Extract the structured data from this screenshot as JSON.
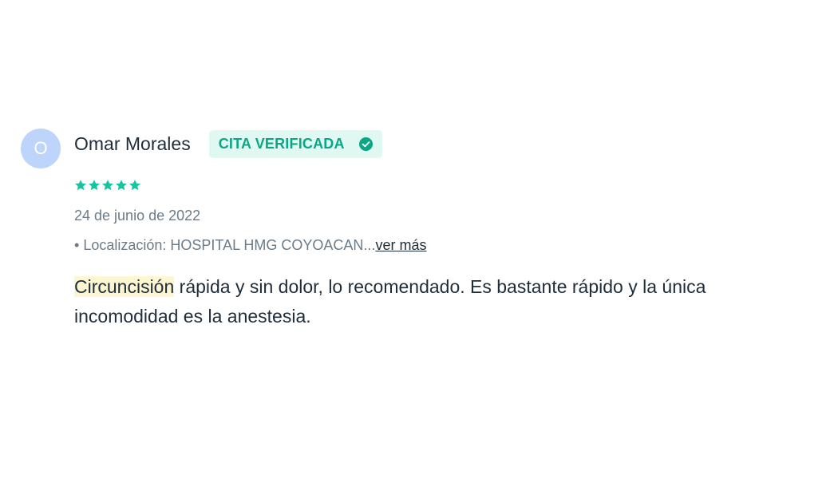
{
  "review": {
    "avatar_initial": "O",
    "author": "Omar Morales",
    "badge_label": "CITA VERIFICADA",
    "rating_value": 5,
    "rating_max": 5,
    "date": "24 de junio de 2022",
    "location_bullet": "•",
    "location_text": "Localización: HOSPITAL HMG COYOACAN...",
    "see_more_label": "ver más",
    "text_highlight": "Circuncisión",
    "text_rest": " rápida y sin dolor, lo recomendado. Es bastante rápido y la única incomodidad es la anestesia."
  },
  "colors": {
    "avatar_bg": "#bdd4fb",
    "badge_bg": "#dff8f2",
    "accent_green": "#0ba686",
    "star_green": "#16c59d",
    "highlight_bg": "#fcf6d2",
    "text_primary": "#1f2d3a",
    "text_secondary": "#6b7b88"
  },
  "icons": {
    "badge_icon": "check-circle-icon",
    "rating_icon": "star-icon"
  }
}
